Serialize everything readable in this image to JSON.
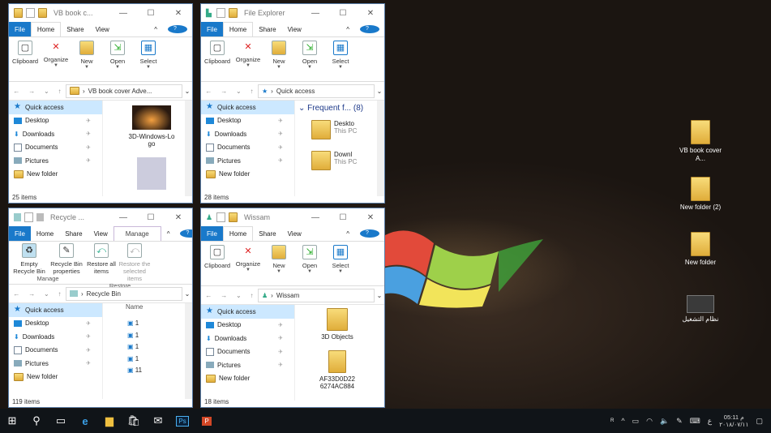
{
  "desktop": {
    "icons": [
      {
        "label": "VB book cover A..."
      },
      {
        "label": "New folder (2)"
      },
      {
        "label": "New folder"
      },
      {
        "label": "نظام التشغيل"
      }
    ]
  },
  "explorer_common": {
    "tab_file": "File",
    "tab_home": "Home",
    "tab_share": "Share",
    "tab_view": "View",
    "rib_clipboard": "Clipboard",
    "rib_organize": "Organize",
    "rib_new": "New",
    "rib_open": "Open",
    "rib_select": "Select",
    "quick_access": "Quick access",
    "nav": [
      "Desktop",
      "Downloads",
      "Documents",
      "Pictures",
      "New folder"
    ]
  },
  "win1": {
    "title": "VB book c...",
    "path": "VB book cover Adve...",
    "item": "3D-Windows-Lo go",
    "status": "25 items"
  },
  "win2": {
    "title": "File Explorer",
    "path": "Quick access",
    "group": "Frequent f... (8)",
    "items": [
      {
        "name": "Deskto",
        "sub": "This PC"
      },
      {
        "name": "Downl",
        "sub": "This PC"
      }
    ],
    "status": "28 items"
  },
  "win3": {
    "title": "Recycle ...",
    "tab_manage": "Manage",
    "rib_empty": "Empty Recycle Bin",
    "rib_props": "Recycle Bin properties",
    "rib_restore_all": "Restore all items",
    "rib_restore_sel": "Restore the selected items",
    "group_manage": "Manage",
    "group_restore": "Restore",
    "path": "Recycle Bin",
    "col_name": "Name",
    "files": [
      "1",
      "1",
      "1",
      "1",
      "11"
    ],
    "status": "119 items"
  },
  "win4": {
    "title": "Wissam",
    "path": "Wissam",
    "items": [
      "3D Objects",
      "AF33D0D22 6274AC884"
    ],
    "status": "18 items"
  },
  "taskbar": {
    "time": "05:11 م",
    "date": "٢٠١٨/٠٧/١١",
    "lang": "ع"
  },
  "colors": {
    "accent": "#1979ca"
  }
}
